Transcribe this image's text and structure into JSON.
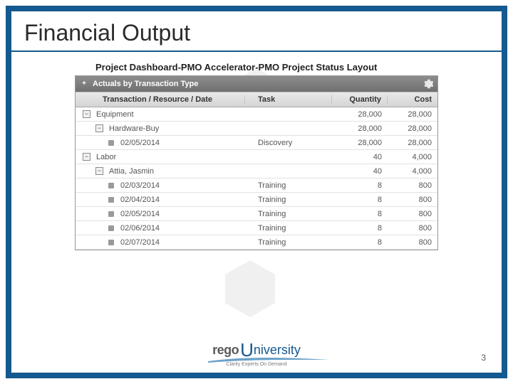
{
  "slide": {
    "title": "Financial Output",
    "subtitle": "Project Dashboard-PMO Accelerator-PMO Project Status Layout",
    "page_number": "3"
  },
  "widget": {
    "header_title": "Actuals by Transaction Type",
    "expand_glyph": "+",
    "columns": {
      "name": "Transaction / Resource / Date",
      "task": "Task",
      "quantity": "Quantity",
      "cost": "Cost"
    },
    "rows": [
      {
        "level": 0,
        "type": "group",
        "toggle": "−",
        "label": "Equipment",
        "task": "",
        "qty": "28,000",
        "cost": "28,000"
      },
      {
        "level": 1,
        "type": "group",
        "toggle": "−",
        "label": "Hardware-Buy",
        "task": "",
        "qty": "28,000",
        "cost": "28,000"
      },
      {
        "level": 2,
        "type": "leaf",
        "toggle": "",
        "label": "02/05/2014",
        "task": "Discovery",
        "qty": "28,000",
        "cost": "28,000"
      },
      {
        "level": 0,
        "type": "group",
        "toggle": "−",
        "label": "Labor",
        "task": "",
        "qty": "40",
        "cost": "4,000"
      },
      {
        "level": 1,
        "type": "group",
        "toggle": "−",
        "label": "Attia, Jasmin",
        "task": "",
        "qty": "40",
        "cost": "4,000"
      },
      {
        "level": 2,
        "type": "leaf",
        "toggle": "",
        "label": "02/03/2014",
        "task": "Training",
        "qty": "8",
        "cost": "800"
      },
      {
        "level": 2,
        "type": "leaf",
        "toggle": "",
        "label": "02/04/2014",
        "task": "Training",
        "qty": "8",
        "cost": "800"
      },
      {
        "level": 2,
        "type": "leaf",
        "toggle": "",
        "label": "02/05/2014",
        "task": "Training",
        "qty": "8",
        "cost": "800"
      },
      {
        "level": 2,
        "type": "leaf",
        "toggle": "",
        "label": "02/06/2014",
        "task": "Training",
        "qty": "8",
        "cost": "800"
      },
      {
        "level": 2,
        "type": "leaf",
        "toggle": "",
        "label": "02/07/2014",
        "task": "Training",
        "qty": "8",
        "cost": "800"
      }
    ]
  },
  "footer": {
    "logo_left": "rego",
    "logo_u": "U",
    "logo_right": "niversity",
    "tagline": "Clarity Experts On Demand"
  }
}
